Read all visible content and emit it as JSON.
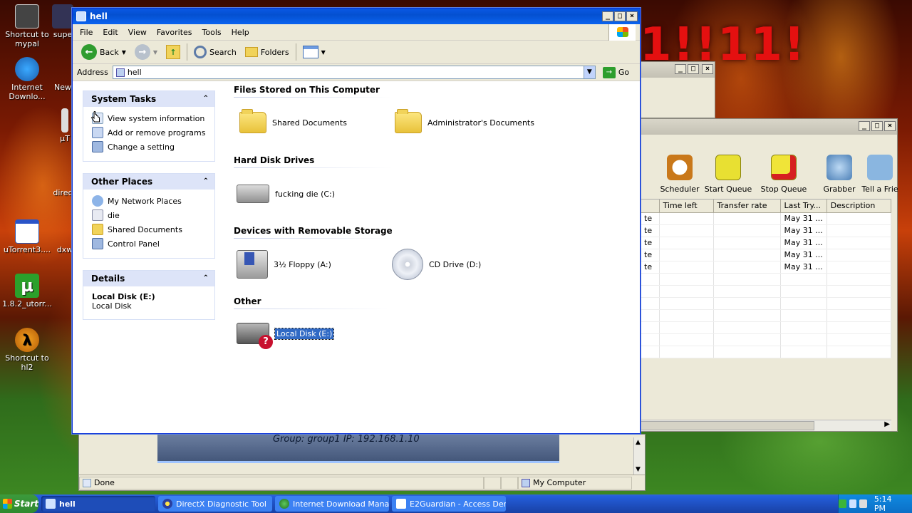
{
  "desktop": {
    "background_text": "1!!11!",
    "icons": [
      {
        "label": "Shortcut to mypal"
      },
      {
        "label": "supe"
      },
      {
        "label": "Internet Downlo..."
      },
      {
        "label": "New"
      },
      {
        "label": "µT"
      },
      {
        "label": "direc"
      },
      {
        "label": "uTorrent3...."
      },
      {
        "label": "dxw"
      },
      {
        "label": "1.8.2_utorr..."
      },
      {
        "label": "Shortcut to hl2"
      }
    ]
  },
  "explorer": {
    "title": "hell",
    "menu": [
      "File",
      "Edit",
      "View",
      "Favorites",
      "Tools",
      "Help"
    ],
    "toolbar": {
      "back": "Back",
      "search": "Search",
      "folders": "Folders"
    },
    "address": {
      "label": "Address",
      "value": "hell",
      "go": "Go"
    },
    "left": {
      "system_tasks": {
        "title": "System Tasks",
        "items": [
          "View system information",
          "Add or remove programs",
          "Change a setting"
        ]
      },
      "other_places": {
        "title": "Other Places",
        "items": [
          "My Network Places",
          "die",
          "Shared Documents",
          "Control Panel"
        ]
      },
      "details": {
        "title": "Details",
        "name": "Local Disk (E:)",
        "type": "Local Disk"
      }
    },
    "sections": {
      "files": {
        "title": "Files Stored on This Computer",
        "items": [
          "Shared Documents",
          "Administrator's Documents"
        ]
      },
      "hdd": {
        "title": "Hard Disk Drives",
        "items": [
          "fucking die (C:)"
        ]
      },
      "removable": {
        "title": "Devices with Removable Storage",
        "items": [
          "3½ Floppy (A:)",
          "CD Drive (D:)"
        ]
      },
      "other": {
        "title": "Other",
        "items": [
          "Local Disk (E:)"
        ]
      }
    },
    "statusbar": {
      "left": "Done",
      "right": "My Computer"
    }
  },
  "idm": {
    "tools": [
      "Scheduler",
      "Start Queue",
      "Stop Queue",
      "Grabber",
      "Tell a Frie"
    ],
    "columns": [
      "",
      "Time left",
      "Transfer rate",
      "Last Try...",
      "Description"
    ],
    "rows": [
      [
        "te",
        "",
        "",
        "May 31 ...",
        ""
      ],
      [
        "te",
        "",
        "",
        "May 31 ...",
        ""
      ],
      [
        "te",
        "",
        "",
        "May 31 ...",
        ""
      ],
      [
        "te",
        "",
        "",
        "May 31 ...",
        ""
      ],
      [
        "te",
        "",
        "",
        "May 31 ...",
        ""
      ]
    ]
  },
  "underlying": {
    "text": "Group: group1   IP: 192.168.1.10"
  },
  "taskbar": {
    "start": "Start",
    "buttons": [
      "hell",
      "DirectX Diagnostic Tool",
      "Internet Download Mana...",
      "E2Guardian - Access Den..."
    ],
    "clock": "5:14 PM"
  },
  "colors": {
    "title_blue": "#0a58e4",
    "panel_header": "#dde4f8",
    "selection": "#316ac5",
    "taskbar": "#245edb",
    "start_green": "#3c9a3c"
  }
}
